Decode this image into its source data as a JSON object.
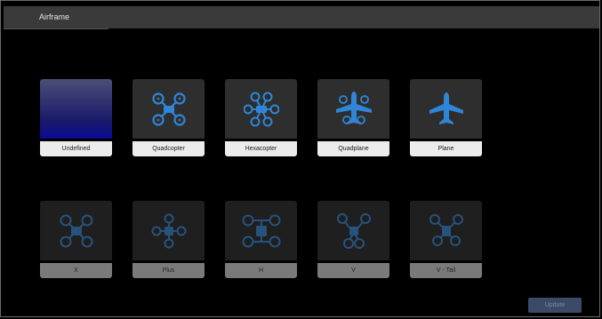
{
  "window": {
    "title": "Airframe"
  },
  "colors": {
    "accent": "#2f86d8",
    "card_bg": "#2e2e2e",
    "label_bg": "#ececec",
    "update_bg": "#3b4a66"
  },
  "frame_types": [
    {
      "label": "Undefined",
      "icon": "gradient-placeholder"
    },
    {
      "label": "Quadcopter",
      "icon": "quadcopter-icon"
    },
    {
      "label": "Hexacopter",
      "icon": "hexacopter-icon"
    },
    {
      "label": "Quadplane",
      "icon": "quadplane-icon"
    },
    {
      "label": "Plane",
      "icon": "plane-icon"
    }
  ],
  "subtypes": [
    {
      "label": "X",
      "icon": "quad-x-icon"
    },
    {
      "label": "Plus",
      "icon": "quad-plus-icon"
    },
    {
      "label": "H",
      "icon": "quad-h-icon"
    },
    {
      "label": "V",
      "icon": "quad-v-icon"
    },
    {
      "label": "V - Tail",
      "icon": "quad-vtail-icon"
    }
  ],
  "actions": {
    "update_label": "Update"
  }
}
